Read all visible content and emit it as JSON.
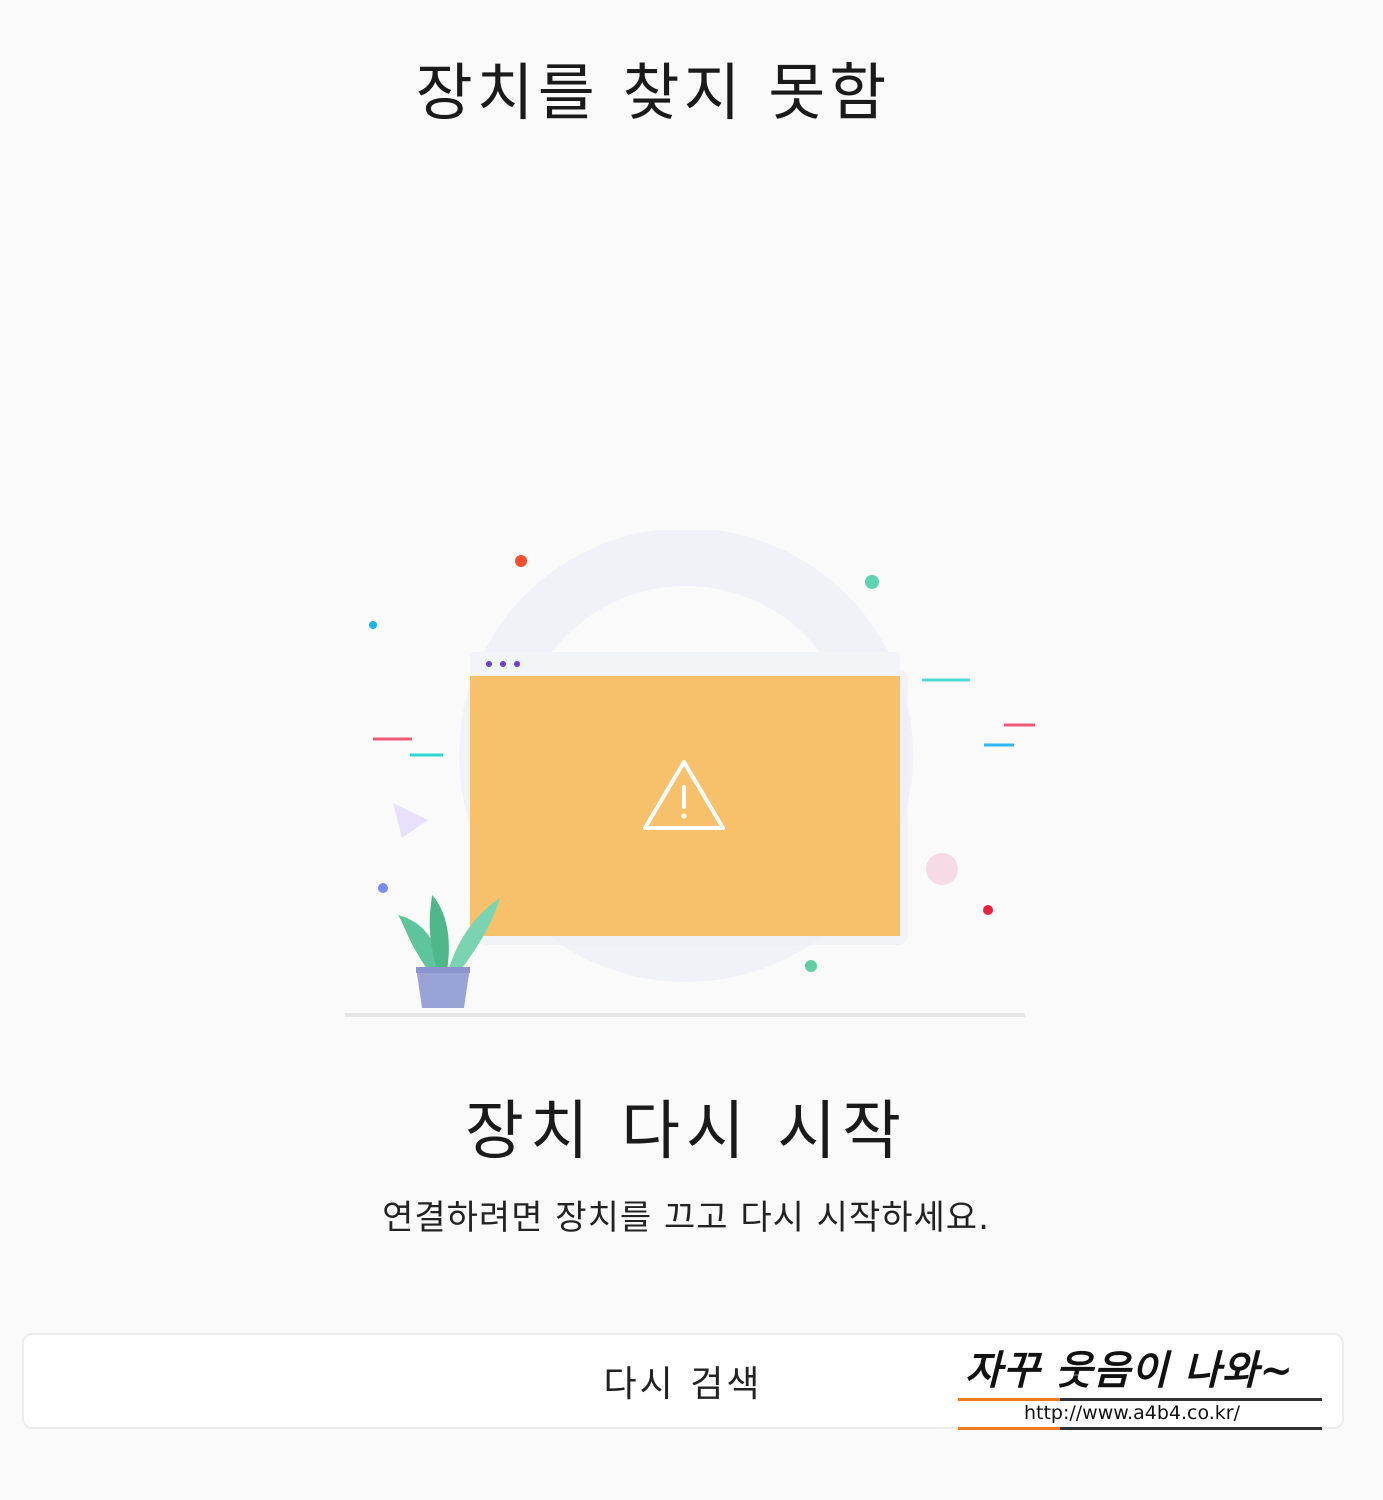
{
  "header": {
    "title": "장치를 찾지 못함"
  },
  "illustration": {
    "window_color": "#f7c06a",
    "window_titlebar_color": "#f3f4f8",
    "window_dots_color": "#6a3fcf",
    "warning_icon": "warning-triangle-icon",
    "plant_icon": "potted-plant-icon"
  },
  "main": {
    "heading": "장치 다시 시작",
    "description": "연결하려면 장치를 끄고 다시 시작하세요."
  },
  "actions": {
    "search_again_label": "다시 검색"
  },
  "watermark": {
    "text": "자꾸 웃음이 나와~",
    "url": "http://www.a4b4.co.kr/"
  }
}
